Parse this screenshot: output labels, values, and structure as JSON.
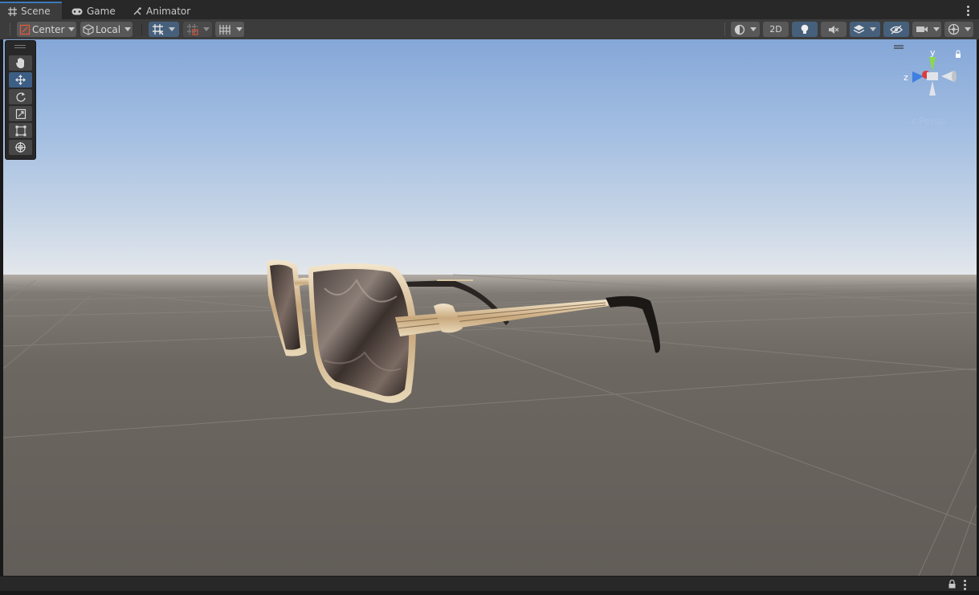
{
  "tabs": [
    {
      "label": "Scene",
      "icon": "grid-icon",
      "active": true
    },
    {
      "label": "Game",
      "icon": "gamepad-icon",
      "active": false
    },
    {
      "label": "Animator",
      "icon": "animator-icon",
      "active": false
    }
  ],
  "toolbar": {
    "pivot_label": "Center",
    "space_label": "Local",
    "mode_2d_label": "2D"
  },
  "gizmo": {
    "y_label": "y",
    "z_label": "z",
    "projection_label": "Persp"
  },
  "colors": {
    "accent": "#3a79bb",
    "active_tool": "#3d5e84",
    "gizmo_x": "#db3d3d",
    "gizmo_y": "#8cd94a",
    "gizmo_z": "#3f7fe0"
  }
}
